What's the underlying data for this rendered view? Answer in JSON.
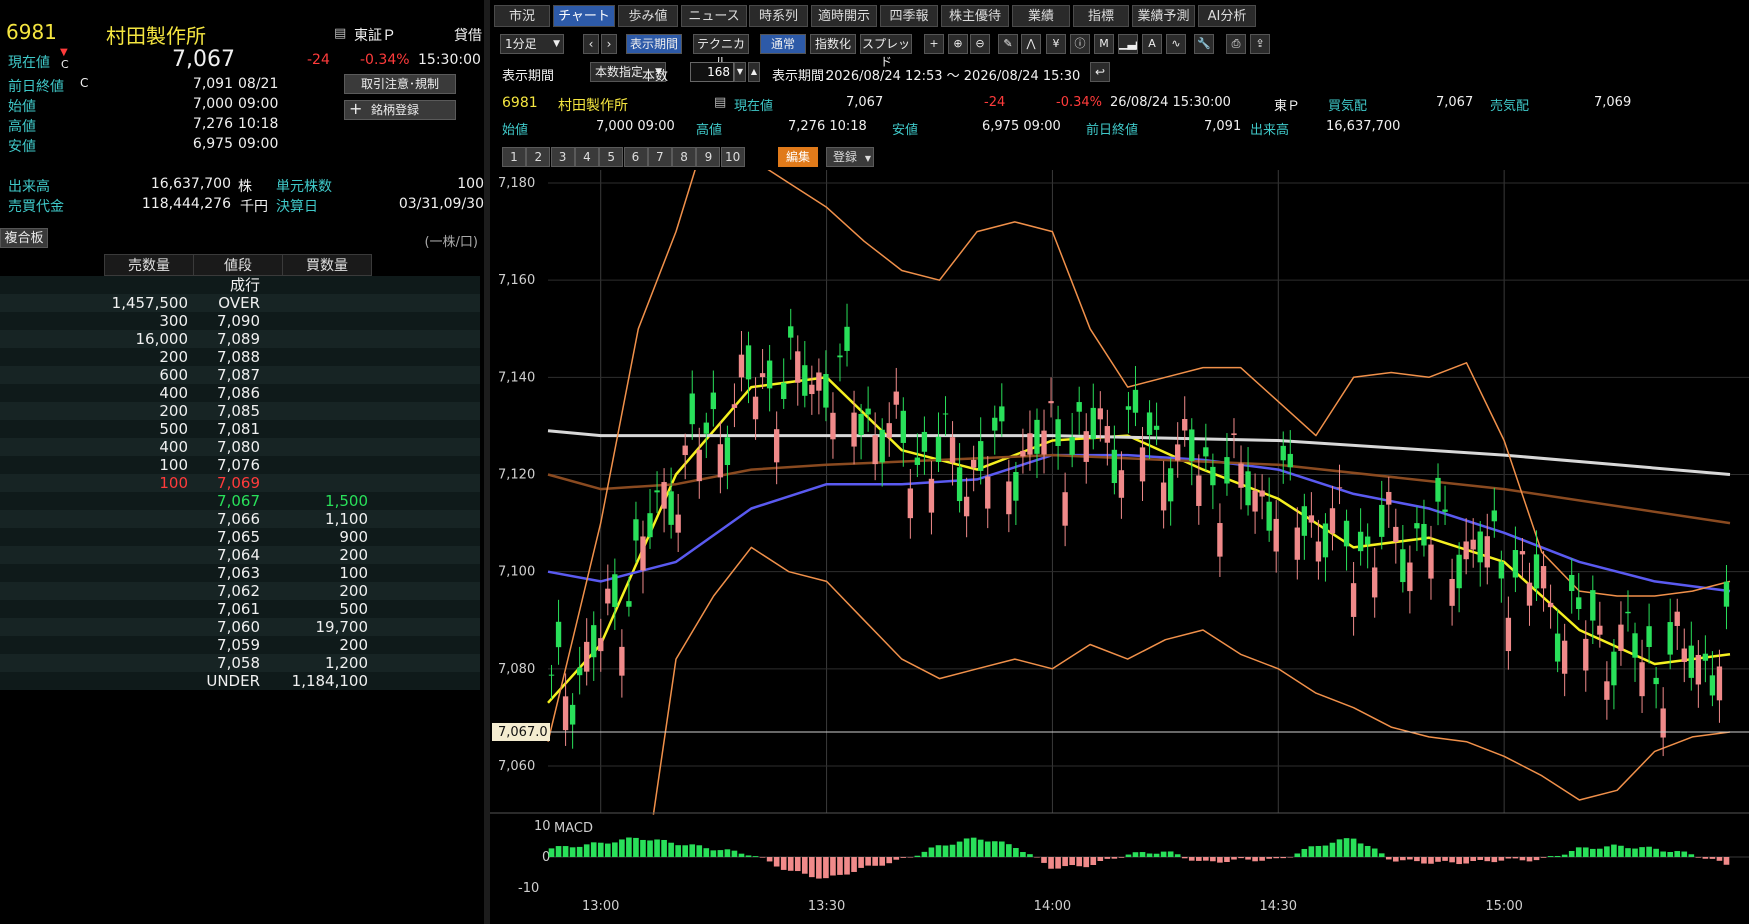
{
  "left": {
    "code": "6981",
    "name": "村田製作所",
    "market": "東証Ｐ",
    "lending": "貸借",
    "current_label": "現在値",
    "current_mark": "C",
    "current_price": "7,067",
    "change": "-24",
    "change_pct": "-0.34%",
    "current_time": "15:30:00",
    "btn_caution": "取引注意･規制",
    "btn_register": "銘柄登録",
    "register_plus": "+",
    "quotes": [
      {
        "label": "前日終値",
        "mark": "C",
        "value": "7,091",
        "time": "08/21"
      },
      {
        "label": "始値",
        "mark": "",
        "value": "7,000",
        "time": "09:00"
      },
      {
        "label": "高値",
        "mark": "",
        "value": "7,276",
        "time": "10:18"
      },
      {
        "label": "安値",
        "mark": "",
        "value": "6,975",
        "time": "09:00"
      }
    ],
    "volume_label": "出来高",
    "volume": "16,637,700",
    "volume_unit": "株",
    "unit_label": "単元株数",
    "unit": "100",
    "turnover_label": "売買代金",
    "turnover": "118,444,276",
    "turnover_unit": "千円",
    "settle_label": "決算日",
    "settle": "03/31,09/30",
    "board_tab": "複合板",
    "per_share": "(一株/口)",
    "book_headers": [
      "売数量",
      "値段",
      "買数量"
    ],
    "book": [
      {
        "sell": "",
        "price": "成行",
        "buy": "",
        "price_color": "white"
      },
      {
        "sell": "1,457,500",
        "price": "OVER",
        "buy": "",
        "price_color": "white"
      },
      {
        "sell": "300",
        "price": "7,090",
        "buy": "",
        "price_color": "white"
      },
      {
        "sell": "16,000",
        "price": "7,089",
        "buy": "",
        "price_color": "white"
      },
      {
        "sell": "200",
        "price": "7,088",
        "buy": "",
        "price_color": "white"
      },
      {
        "sell": "600",
        "price": "7,087",
        "buy": "",
        "price_color": "white"
      },
      {
        "sell": "400",
        "price": "7,086",
        "buy": "",
        "price_color": "white"
      },
      {
        "sell": "200",
        "price": "7,085",
        "buy": "",
        "price_color": "white"
      },
      {
        "sell": "500",
        "price": "7,081",
        "buy": "",
        "price_color": "white"
      },
      {
        "sell": "400",
        "price": "7,080",
        "buy": "",
        "price_color": "white"
      },
      {
        "sell": "100",
        "price": "7,076",
        "buy": "",
        "price_color": "white"
      },
      {
        "sell": "100",
        "price": "7,069",
        "buy": "",
        "price_color": "red"
      },
      {
        "sell": "",
        "price": "7,067",
        "buy": "1,500",
        "price_color": "green"
      },
      {
        "sell": "",
        "price": "7,066",
        "buy": "1,100",
        "price_color": "white"
      },
      {
        "sell": "",
        "price": "7,065",
        "buy": "900",
        "price_color": "white"
      },
      {
        "sell": "",
        "price": "7,064",
        "buy": "200",
        "price_color": "white"
      },
      {
        "sell": "",
        "price": "7,063",
        "buy": "100",
        "price_color": "white"
      },
      {
        "sell": "",
        "price": "7,062",
        "buy": "200",
        "price_color": "white"
      },
      {
        "sell": "",
        "price": "7,061",
        "buy": "500",
        "price_color": "white"
      },
      {
        "sell": "",
        "price": "7,060",
        "buy": "19,700",
        "price_color": "white"
      },
      {
        "sell": "",
        "price": "7,059",
        "buy": "200",
        "price_color": "white"
      },
      {
        "sell": "",
        "price": "7,058",
        "buy": "1,200",
        "price_color": "white"
      },
      {
        "sell": "",
        "price": "UNDER",
        "buy": "1,184,100",
        "price_color": "white"
      }
    ]
  },
  "tabs": [
    "市況",
    "チャート",
    "歩み値",
    "ニュース",
    "時系列",
    "適時開示",
    "四季報",
    "株主優待",
    "業績",
    "指標",
    "業績予測",
    "AI分析"
  ],
  "active_tab": 1,
  "toolbar": {
    "interval": "1分足",
    "display_period": "表示期間",
    "technical": "テクニカル",
    "normal": "通常",
    "index": "指数化",
    "spread": "スプレッド"
  },
  "period_row": {
    "label": "表示期間",
    "mode": "本数指定",
    "count_label": "本数",
    "count": "168",
    "range_label": "表示期間：",
    "range": "2026/08/24 12:53 ～ 2026/08/24 15:30"
  },
  "info": {
    "code": "6981",
    "name": "村田製作所",
    "current_label": "現在値",
    "current": "7,067",
    "change": "-24",
    "change_pct": "-0.34%",
    "datetime": "26/08/24  15:30:00",
    "market": "東Ｐ",
    "bid_label": "買気配",
    "bid": "7,067",
    "ask_label": "売気配",
    "ask": "7,069",
    "open_label": "始値",
    "open": "7,000  09:00",
    "high_label": "高値",
    "high": "7,276  10:18",
    "low_label": "安値",
    "low": "6,975  09:00",
    "prev_label": "前日終値",
    "prev": "7,091",
    "vol_label": "出来高",
    "vol": "16,637,700"
  },
  "pages": [
    "1",
    "2",
    "3",
    "4",
    "5",
    "6",
    "7",
    "8",
    "9",
    "10"
  ],
  "edit_label": "編集",
  "register_label": "登録",
  "colors": {
    "up": "#29e05a",
    "down": "#f08a8a",
    "bollinger": "#f0904a",
    "ma_short": "#f5f020",
    "ma_mid": "#5a5af0",
    "ma_long": "#8a4a20",
    "ma_vlong": "#d8d8d8"
  },
  "chart_data": {
    "type": "candlestick",
    "y_ticks": [
      "7,180",
      "7,160",
      "7,140",
      "7,120",
      "7,100",
      "7,080",
      "7,060"
    ],
    "ylim": [
      7050,
      7181
    ],
    "x_ticks": [
      "13:00",
      "13:30",
      "14:00",
      "14:30",
      "15:00"
    ],
    "current_price_label": "7,067.0",
    "current_price": 7067,
    "macd_label": "MACD",
    "macd_ticks": [
      "10",
      "0",
      "-10"
    ],
    "series": [
      {
        "name": "short MA",
        "x": [
          "12:53",
          "13:00",
          "13:10",
          "13:20",
          "13:30",
          "13:40",
          "13:50",
          "14:00",
          "14:10",
          "14:20",
          "14:30",
          "14:40",
          "14:50",
          "15:00",
          "15:10",
          "15:20",
          "15:30"
        ],
        "values": [
          7073,
          7085,
          7120,
          7138,
          7140,
          7125,
          7121,
          7127,
          7128,
          7121,
          7115,
          7105,
          7107,
          7102,
          7088,
          7081,
          7083
        ]
      },
      {
        "name": "mid MA",
        "x": [
          "12:53",
          "13:00",
          "13:10",
          "13:20",
          "13:30",
          "13:40",
          "13:50",
          "14:00",
          "14:10",
          "14:20",
          "14:30",
          "14:40",
          "14:50",
          "15:00",
          "15:10",
          "15:20",
          "15:30"
        ],
        "values": [
          7100,
          7098,
          7102,
          7113,
          7118,
          7118,
          7119,
          7124,
          7124,
          7123,
          7121,
          7116,
          7113,
          7108,
          7102,
          7098,
          7096
        ]
      },
      {
        "name": "long MA",
        "x": [
          "12:53",
          "13:00",
          "13:10",
          "13:20",
          "13:30",
          "14:00",
          "14:30",
          "15:00",
          "15:30"
        ],
        "values": [
          7120,
          7117,
          7118,
          7121,
          7122,
          7124,
          7122,
          7117,
          7110
        ]
      },
      {
        "name": "very long MA",
        "x": [
          "12:53",
          "13:00",
          "13:30",
          "14:00",
          "14:30",
          "15:00",
          "15:30"
        ],
        "values": [
          7129,
          7128,
          7128,
          7128,
          7127,
          7124,
          7120
        ]
      },
      {
        "name": "bollinger upper",
        "x": [
          "12:53",
          "13:00",
          "13:05",
          "13:10",
          "13:15",
          "13:20",
          "13:25",
          "13:30",
          "13:35",
          "13:40",
          "13:45",
          "13:50",
          "13:55",
          "14:00",
          "14:05",
          "14:10",
          "14:15",
          "14:20",
          "14:25",
          "14:30",
          "14:35",
          "14:40",
          "14:45",
          "14:50",
          "14:55",
          "15:00",
          "15:05",
          "15:10",
          "15:15",
          "15:20",
          "15:25",
          "15:30"
        ],
        "values": [
          7065,
          7110,
          7150,
          7170,
          7195,
          7185,
          7180,
          7175,
          7168,
          7162,
          7160,
          7170,
          7172,
          7170,
          7150,
          7138,
          7140,
          7142,
          7142,
          7135,
          7128,
          7140,
          7141,
          7140,
          7143,
          7127,
          7104,
          7096,
          7095,
          7095,
          7096,
          7098
        ]
      },
      {
        "name": "bollinger lower",
        "x": [
          "13:07",
          "13:10",
          "13:15",
          "13:20",
          "13:25",
          "13:30",
          "13:35",
          "13:40",
          "13:45",
          "13:50",
          "13:55",
          "14:00",
          "14:05",
          "14:10",
          "14:15",
          "14:20",
          "14:25",
          "14:30",
          "14:35",
          "14:40",
          "14:45",
          "14:50",
          "14:55",
          "15:00",
          "15:05",
          "15:10",
          "15:15",
          "15:20",
          "15:25",
          "15:30"
        ],
        "values": [
          7050,
          7082,
          7095,
          7105,
          7100,
          7098,
          7090,
          7082,
          7078,
          7080,
          7082,
          7080,
          7085,
          7082,
          7086,
          7088,
          7083,
          7080,
          7075,
          7072,
          7068,
          7066,
          7065,
          7062,
          7058,
          7053,
          7055,
          7063,
          7066,
          7067
        ]
      }
    ],
    "macd": {
      "x": [
        "12:53",
        "13:00",
        "13:05",
        "13:10",
        "13:15",
        "13:20",
        "13:25",
        "13:30",
        "13:35",
        "13:40",
        "13:45",
        "13:50",
        "13:55",
        "14:00",
        "14:05",
        "14:10",
        "14:15",
        "14:20",
        "14:25",
        "14:30",
        "14:35",
        "14:40",
        "14:45",
        "14:50",
        "14:55",
        "15:00",
        "15:05",
        "15:10",
        "15:15",
        "15:20",
        "15:25",
        "15:30"
      ],
      "values": [
        3,
        5,
        7,
        5,
        3,
        1,
        -5,
        -8,
        -4,
        -1,
        4,
        7,
        4,
        -4,
        -3,
        1,
        2,
        -2,
        -1,
        -1,
        4,
        7,
        -1,
        -2,
        -2,
        -1,
        -1,
        3,
        4,
        3,
        1,
        -3
      ]
    }
  }
}
